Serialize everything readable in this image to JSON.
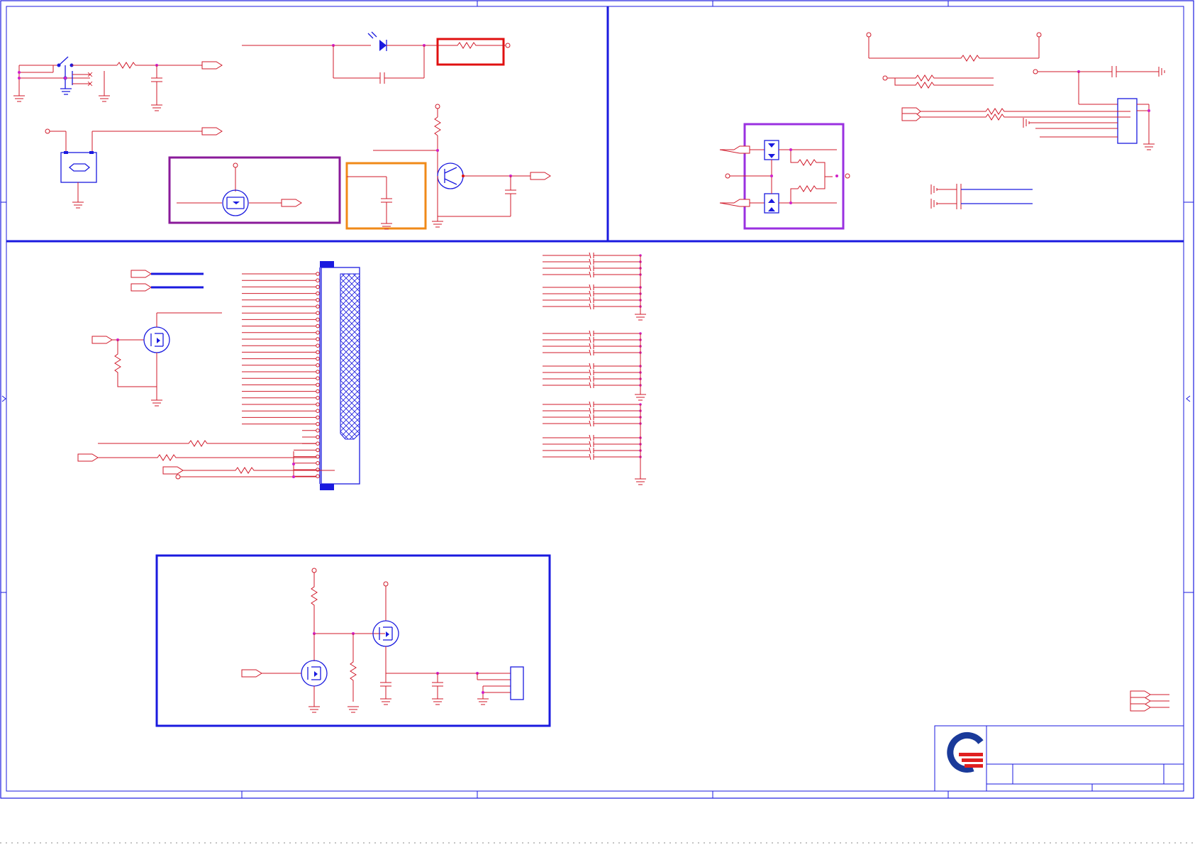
{
  "sheet": {
    "page_border_color": "#1a1adf",
    "wire_color": "#d01a2a",
    "symbol_color": "#1a1adf",
    "junction_color": "#d020c8"
  },
  "highlights": {
    "red": "#e01010",
    "purple": "#8a1a9a",
    "orange": "#f08a18",
    "violet": "#9a30e0",
    "blue": "#1a1adf"
  },
  "title_block": {
    "logo": "company-logo",
    "logo_colors": [
      "#1a3a9a",
      "#e02020"
    ]
  },
  "icons": [
    "mosfet-symbol",
    "transistor-symbol",
    "resistor-symbol",
    "capacitor-symbol",
    "ground-symbol",
    "led-symbol",
    "connector-symbol",
    "switch-symbol",
    "diode-symbol"
  ]
}
